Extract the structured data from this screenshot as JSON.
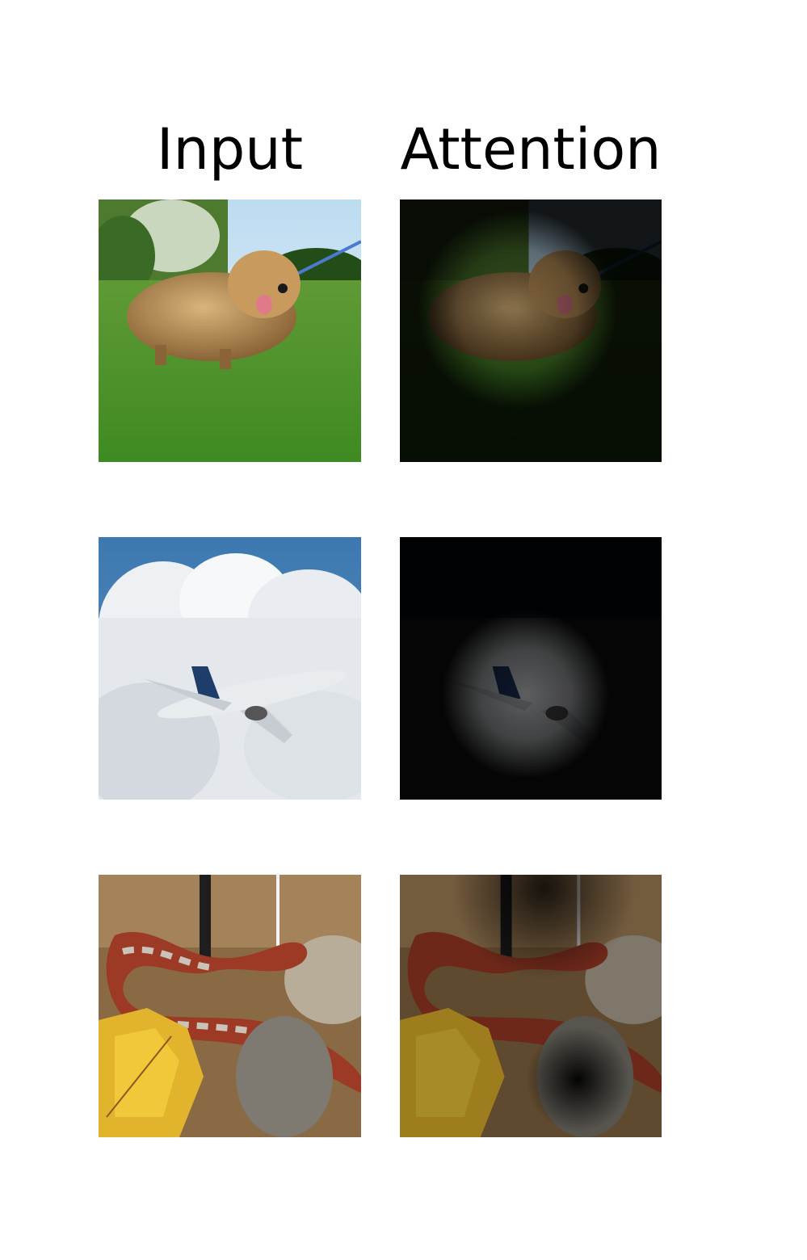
{
  "columns": {
    "input": "Input",
    "attention": "Attention"
  },
  "rows": [
    {
      "subject": "dog",
      "input_icon": "dog-on-grass-photo",
      "attention_icon": "dog-attention-map"
    },
    {
      "subject": "airplane",
      "input_icon": "airplane-in-clouds-photo",
      "attention_icon": "airplane-attention-map"
    },
    {
      "subject": "snake",
      "input_icon": "snake-on-leaves-photo",
      "attention_icon": "snake-attention-map"
    }
  ]
}
